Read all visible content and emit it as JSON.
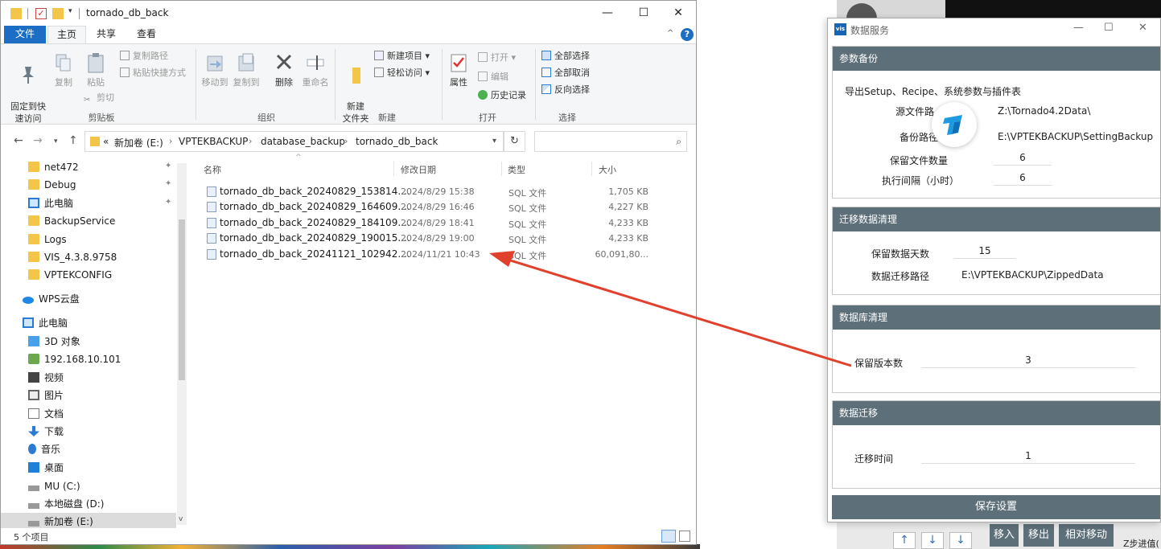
{
  "explorer": {
    "title": "tornado_db_back",
    "quick_access_dropdown": "▾",
    "window_controls": {
      "minimize": "—",
      "maximize": "☐",
      "close": "✕"
    },
    "tabs": {
      "file": "文件",
      "home": "主页",
      "share": "共享",
      "view": "查看"
    },
    "ribbon": {
      "clipboard": {
        "pin": "固定到快\n速访问",
        "copy": "复制",
        "paste": "粘贴",
        "copy_path": "复制路径",
        "paste_shortcut": "粘贴快捷方式",
        "cut": "剪切",
        "group": "剪贴板"
      },
      "organize": {
        "move_to": "移动到",
        "copy_to": "复制到",
        "delete": "删除",
        "rename": "重命名",
        "group": "组织"
      },
      "new": {
        "new_folder": "新建\n文件夹",
        "new_item": "新建项目 ▾",
        "easy_access": "轻松访问 ▾",
        "group": "新建"
      },
      "open": {
        "properties": "属性",
        "open": "打开 ▾",
        "edit": "编辑",
        "history": "历史记录",
        "group": "打开"
      },
      "select": {
        "select_all": "全部选择",
        "select_none": "全部取消",
        "invert": "反向选择",
        "group": "选择"
      }
    },
    "address": {
      "prefix": "«",
      "crumbs": [
        "新加卷 (E:)",
        "VPTEKBACKUP",
        "database_backup",
        "tornado_db_back"
      ],
      "separator": "›"
    },
    "nav_buttons": {
      "back": "←",
      "forward": "→",
      "recent": "▾",
      "up": "↑"
    },
    "nav_pane": {
      "items": [
        {
          "label": "net472",
          "pinned": true
        },
        {
          "label": "Debug",
          "pinned": true
        },
        {
          "label": "此电脑",
          "pinned": true
        },
        {
          "label": "BackupService",
          "pinned": false
        },
        {
          "label": "Logs",
          "pinned": false
        },
        {
          "label": "VIS_4.3.8.9758",
          "pinned": false
        },
        {
          "label": "VPTEKCONFIG",
          "pinned": false
        },
        {
          "label": "WPS云盘",
          "pinned": false
        },
        {
          "label": "此电脑",
          "pinned": false
        },
        {
          "label": "3D 对象",
          "pinned": false
        },
        {
          "label": "192.168.10.101",
          "pinned": false
        },
        {
          "label": "视频",
          "pinned": false
        },
        {
          "label": "图片",
          "pinned": false
        },
        {
          "label": "文档",
          "pinned": false
        },
        {
          "label": "下载",
          "pinned": false
        },
        {
          "label": "音乐",
          "pinned": false
        },
        {
          "label": "桌面",
          "pinned": false
        },
        {
          "label": "MU (C:)",
          "pinned": false
        },
        {
          "label": "本地磁盘 (D:)",
          "pinned": false
        },
        {
          "label": "新加卷 (E:)",
          "pinned": false
        }
      ]
    },
    "columns": {
      "name": "名称",
      "modified": "修改日期",
      "type": "类型",
      "size": "大小"
    },
    "files": [
      {
        "name": "tornado_db_back_20240829_153814....",
        "modified": "2024/8/29 15:38",
        "type": "SQL 文件",
        "size": "1,705 KB"
      },
      {
        "name": "tornado_db_back_20240829_164609....",
        "modified": "2024/8/29 16:46",
        "type": "SQL 文件",
        "size": "4,227 KB"
      },
      {
        "name": "tornado_db_back_20240829_184109....",
        "modified": "2024/8/29 18:41",
        "type": "SQL 文件",
        "size": "4,233 KB"
      },
      {
        "name": "tornado_db_back_20240829_190015....",
        "modified": "2024/8/29 19:00",
        "type": "SQL 文件",
        "size": "4,233 KB"
      },
      {
        "name": "tornado_db_back_20241121_102942....",
        "modified": "2024/11/21 10:43",
        "type": "SQL 文件",
        "size": "60,091,80..."
      }
    ],
    "status": {
      "count": "5 个项目"
    }
  },
  "service": {
    "logo": "vis",
    "title": "数据服务",
    "controls": {
      "minimize": "—",
      "maximize": "☐",
      "close": "✕"
    },
    "param_backup": {
      "header": "参数备份",
      "description": "导出Setup、Recipe、系统参数与插件表",
      "source_label": "源文件路",
      "source_path": "Z:\\Tornado4.2Data\\",
      "backup_label": "备份路径",
      "backup_path": "E:\\VPTEKBACKUP\\SettingBackup",
      "keep_count_label": "保留文件数量",
      "keep_count": "6",
      "interval_label": "执行间隔（小时）",
      "interval": "6"
    },
    "migrate_cleanup": {
      "header": "迁移数据清理",
      "keep_days_label": "保留数据天数",
      "keep_days": "15",
      "path_label": "数据迁移路径",
      "path": "E:\\VPTEKBACKUP\\ZippedData"
    },
    "db_cleanup": {
      "header": "数据库清理",
      "keep_versions_label": "保留版本数",
      "keep_versions": "3"
    },
    "migration": {
      "header": "数据迁移",
      "time_label": "迁移时间",
      "time": "1"
    },
    "save_button": "保存设置"
  },
  "background": {
    "buttons": [
      "移入",
      "移出",
      "相对移动"
    ],
    "step_label": "Z步进值(",
    "arrows": [
      "↑",
      "↓",
      "↓",
      "↓"
    ]
  },
  "colors": {
    "accent": "#1c6ec4",
    "section_header": "#5d6f78",
    "arrow": "#e0402c"
  }
}
